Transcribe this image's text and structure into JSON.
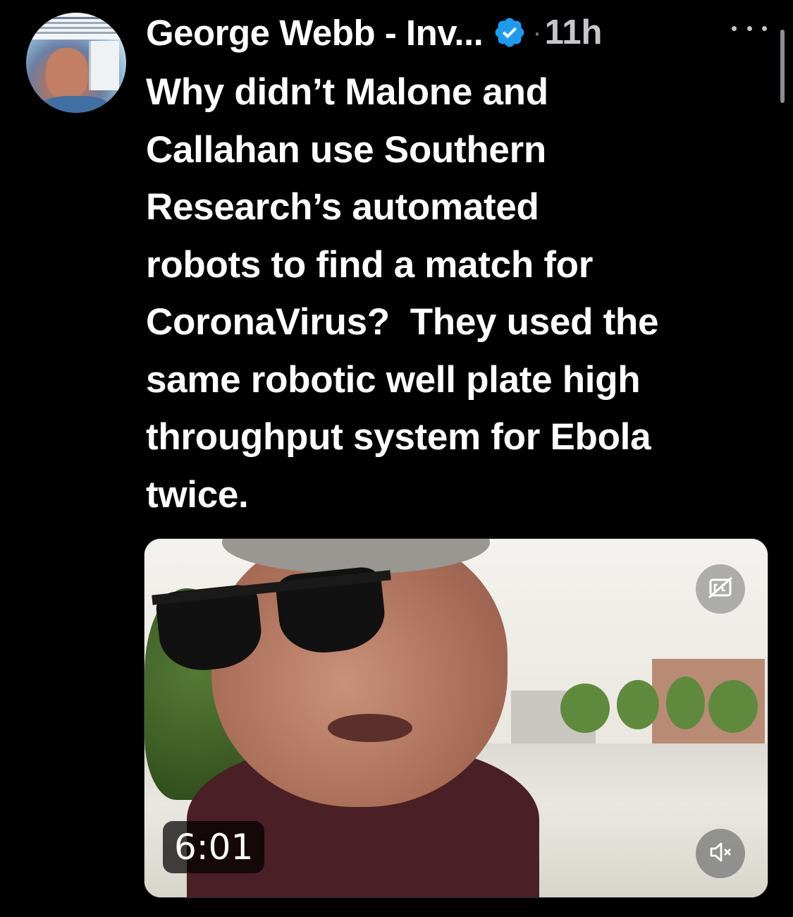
{
  "author": {
    "name": "George Webb - Inv...",
    "verified_icon": "verified-badge-icon",
    "separator": "·",
    "timestamp": "11h"
  },
  "tweet": {
    "text": "Why didn’t Malone and\nCallahan use Southern\nResearch’s automated\nrobots to find a match for\nCoronaVirus?  They used the\nsame robotic well plate high\nthroughput system for Ebola\ntwice."
  },
  "media": {
    "type": "video",
    "duration": "6:01",
    "captions_icon": "closed-captions-off-icon",
    "mute_icon": "speaker-muted-icon"
  },
  "colors": {
    "background": "#000000",
    "text": "#ffffff",
    "muted": "#71767b",
    "verified": "#1d9bf0"
  }
}
